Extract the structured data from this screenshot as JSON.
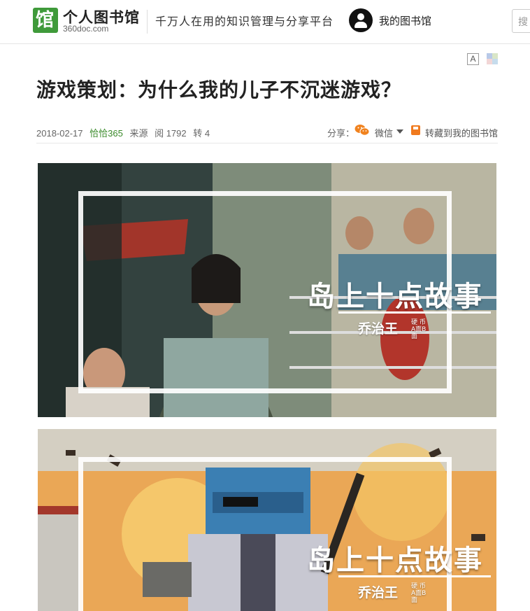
{
  "header": {
    "logo_glyph": "馆",
    "logo_title": "个人图书馆",
    "logo_sub": "360doc.com",
    "slogan": "千万人在用的知识管理与分享平台",
    "my_library": "我的图书馆",
    "search_placeholder": "搜"
  },
  "tools": {
    "font_label": "A"
  },
  "article": {
    "title": "游戏策划：为什么我的儿子不沉迷游戏？",
    "date": "2018-02-17",
    "author": "恰恰365",
    "source": "来源",
    "reads": "阅 1792",
    "shares": "转 4",
    "share_label": "分享：",
    "wechat_label": "微信",
    "save_label": "转藏到我的图书馆"
  },
  "images": [
    {
      "overlay_title": "岛上十点故事",
      "overlay_author": "乔治王",
      "overlay_tag": "硬 币 A面B面"
    },
    {
      "overlay_title": "岛上十点故事",
      "overlay_author": "乔治王",
      "overlay_tag": "硬 币 A面B面"
    }
  ],
  "colors": {
    "brand_green": "#3f9a3a",
    "author_green": "#3a8a2a",
    "save_orange": "#f07a1e",
    "wechat_orange": "#f0821e"
  }
}
